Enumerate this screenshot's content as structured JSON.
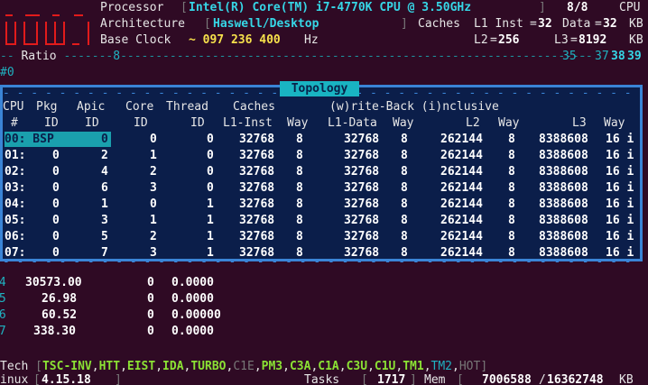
{
  "header": {
    "processor_label": "Processor",
    "processor_value": "Intel(R) Core(TM) i7-4770K CPU @ 3.50GHz",
    "cpu_count": "8/8",
    "cpu_label": "CPU",
    "architecture_label": "Architecture",
    "architecture_value": "Haswell/Desktop",
    "caches_label": "Caches",
    "l1_inst_label": "L1 Inst",
    "l1_inst_value": "32",
    "l1_data_label": "Data",
    "l1_data_value": "32",
    "kb1": "KB",
    "base_clock_label": "Base Clock",
    "base_clock_value": "~ 097 236 400",
    "hz": "Hz",
    "l2_label": "L2",
    "l2_value": "256",
    "l3_label": "L3",
    "l3_value": "8192",
    "kb2": "KB",
    "ratio_label": "Ratio",
    "ratio_min": "8",
    "ratio_a": "35",
    "ratio_b": "37",
    "ratio_c": "38",
    "ratio_d": "39",
    "row0_marker": "#0"
  },
  "topology": {
    "title": "Topology",
    "header1": [
      "CPU",
      "Pkg",
      "Apic",
      "Core",
      "Thread",
      "Caches",
      "(w)rite-Back (i)nclusive"
    ],
    "header2": [
      "#",
      "ID",
      "ID",
      "ID",
      "ID",
      "L1-Inst",
      "Way",
      "L1-Data",
      "Way",
      "L2",
      "Way",
      "L3",
      "Way"
    ],
    "rows": [
      {
        "cpu": "00: BSP",
        "apic": "0",
        "core": "0",
        "thread": "0",
        "l1i": "32768",
        "l1iw": "8",
        "l1d": "32768",
        "l1dw": "8",
        "l2": "262144",
        "l2w": "8",
        "l3": "8388608",
        "l3w": "16 i",
        "pkg": ""
      },
      {
        "cpu": "01:",
        "pkg": "0",
        "apic": "2",
        "core": "1",
        "thread": "0",
        "l1i": "32768",
        "l1iw": "8",
        "l1d": "32768",
        "l1dw": "8",
        "l2": "262144",
        "l2w": "8",
        "l3": "8388608",
        "l3w": "16 i"
      },
      {
        "cpu": "02:",
        "pkg": "0",
        "apic": "4",
        "core": "2",
        "thread": "0",
        "l1i": "32768",
        "l1iw": "8",
        "l1d": "32768",
        "l1dw": "8",
        "l2": "262144",
        "l2w": "8",
        "l3": "8388608",
        "l3w": "16 i"
      },
      {
        "cpu": "03:",
        "pkg": "0",
        "apic": "6",
        "core": "3",
        "thread": "0",
        "l1i": "32768",
        "l1iw": "8",
        "l1d": "32768",
        "l1dw": "8",
        "l2": "262144",
        "l2w": "8",
        "l3": "8388608",
        "l3w": "16 i"
      },
      {
        "cpu": "04:",
        "pkg": "0",
        "apic": "1",
        "core": "0",
        "thread": "1",
        "l1i": "32768",
        "l1iw": "8",
        "l1d": "32768",
        "l1dw": "8",
        "l2": "262144",
        "l2w": "8",
        "l3": "8388608",
        "l3w": "16 i"
      },
      {
        "cpu": "05:",
        "pkg": "0",
        "apic": "3",
        "core": "1",
        "thread": "1",
        "l1i": "32768",
        "l1iw": "8",
        "l1d": "32768",
        "l1dw": "8",
        "l2": "262144",
        "l2w": "8",
        "l3": "8388608",
        "l3w": "16 i"
      },
      {
        "cpu": "06:",
        "pkg": "0",
        "apic": "5",
        "core": "2",
        "thread": "1",
        "l1i": "32768",
        "l1iw": "8",
        "l1d": "32768",
        "l1dw": "8",
        "l2": "262144",
        "l2w": "8",
        "l3": "8388608",
        "l3w": "16 i"
      },
      {
        "cpu": "07:",
        "pkg": "0",
        "apic": "7",
        "core": "3",
        "thread": "1",
        "l1i": "32768",
        "l1iw": "8",
        "l1d": "32768",
        "l1dw": "8",
        "l2": "262144",
        "l2w": "8",
        "l3": "8388608",
        "l3w": "16 i"
      }
    ]
  },
  "frequency": [
    {
      "num": "#4",
      "freq": "30573.00",
      "a": "0",
      "b": "0.0000"
    },
    {
      "num": "#5",
      "freq": "26.98",
      "a": "0",
      "b": "0.0000"
    },
    {
      "num": "#6",
      "freq": "60.52",
      "a": "0",
      "b": "0.00000"
    },
    {
      "num": "#7",
      "freq": "338.30",
      "a": "0",
      "b": "0.0000"
    }
  ],
  "footer": {
    "tech_label": "Tech",
    "tech_on": [
      "TSC-INV",
      "HTT",
      "EIST",
      "IDA",
      "TURBO"
    ],
    "tech_c1e": "C1E",
    "tech_on2": [
      "PM3",
      "C3A",
      "C1A",
      "C3U",
      "C1U",
      "TM1"
    ],
    "tech_tm2": "TM2",
    "tech_hot": "HOT",
    "os_label": "inux",
    "kernel": "4.15.18",
    "tasks_label": "Tasks",
    "tasks_value": "1717",
    "mem_label": "Mem",
    "mem_used": "7006588",
    "mem_total": "16362748",
    "mem_unit": "KB"
  },
  "colors": {
    "background": "#2f0a24",
    "panel": "#0b1e4a",
    "panel_border": "#3a84d6",
    "accent": "#19b4c2",
    "value_yellow": "#f6e04b",
    "logo_red": "#e21b1b"
  }
}
